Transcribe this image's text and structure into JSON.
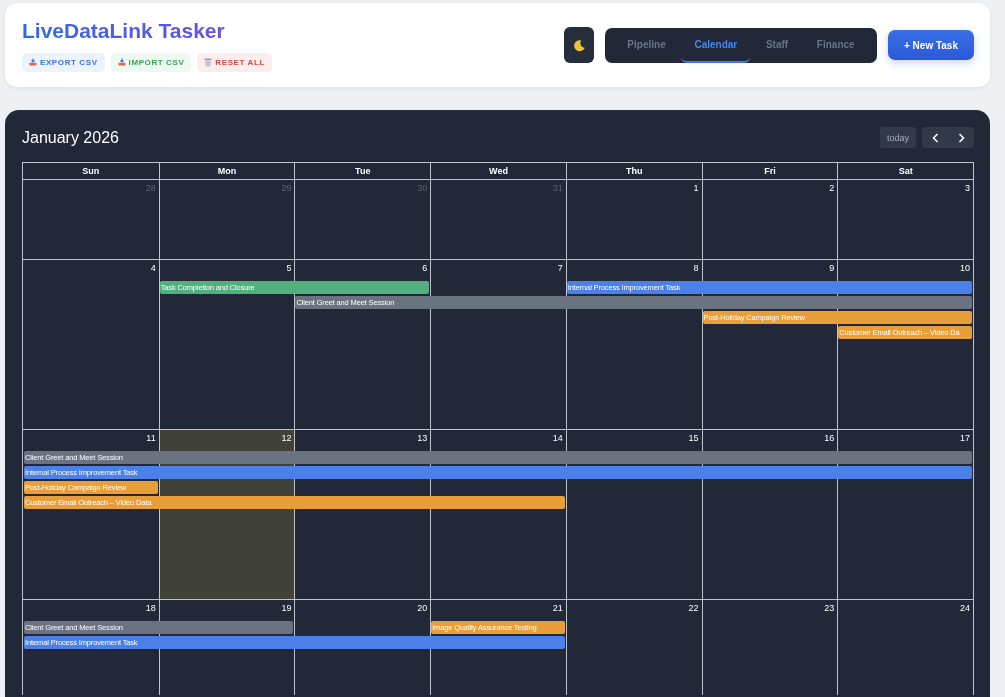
{
  "app": {
    "title": "LiveDataLink Tasker"
  },
  "actions": [
    {
      "label": "EXPORT CSV",
      "kind": "export"
    },
    {
      "label": "IMPORT CSV",
      "kind": "import"
    },
    {
      "label": "RESET ALL",
      "kind": "reset"
    }
  ],
  "theme_toggle": {
    "dark": true
  },
  "tabs": [
    {
      "label": "Pipeline",
      "selected": false
    },
    {
      "label": "Calendar",
      "selected": true
    },
    {
      "label": "Staff",
      "selected": false
    },
    {
      "label": "Finance",
      "selected": false
    }
  ],
  "new_task_button": "+ New Task",
  "calendar": {
    "title": "January 2026",
    "today_button": "today",
    "weekdays": [
      "Sun",
      "Mon",
      "Tue",
      "Wed",
      "Thu",
      "Fri",
      "Sat"
    ],
    "weeks": [
      {
        "days": [
          {
            "number": "28",
            "other_month": true,
            "today": false
          },
          {
            "number": "29",
            "other_month": true,
            "today": false
          },
          {
            "number": "30",
            "other_month": true,
            "today": false
          },
          {
            "number": "31",
            "other_month": true,
            "today": false
          },
          {
            "number": "1",
            "other_month": false,
            "today": false
          },
          {
            "number": "2",
            "other_month": false,
            "today": false
          },
          {
            "number": "3",
            "other_month": false,
            "today": false
          }
        ]
      },
      {
        "days": [
          {
            "number": "4",
            "other_month": false,
            "today": false
          },
          {
            "number": "5",
            "other_month": false,
            "today": false
          },
          {
            "number": "6",
            "other_month": false,
            "today": false
          },
          {
            "number": "7",
            "other_month": false,
            "today": false
          },
          {
            "number": "8",
            "other_month": false,
            "today": false
          },
          {
            "number": "9",
            "other_month": false,
            "today": false
          },
          {
            "number": "10",
            "other_month": false,
            "today": false
          }
        ],
        "events": [
          {
            "title": "Task Completion and Closure",
            "color": "#52b07e"
          },
          {
            "title": "Internal Process Improvement Task",
            "color": "#4a80e8"
          },
          {
            "title": "Client Greet and Meet Session",
            "color": "#6b7280"
          },
          {
            "title": "Post-Holiday Campaign Review",
            "color": "#e89f3a"
          },
          {
            "title": "Customer Email Outreach – Video Da",
            "color": "#e89f3a"
          }
        ]
      },
      {
        "days": [
          {
            "number": "11",
            "other_month": false,
            "today": false
          },
          {
            "number": "12",
            "other_month": false,
            "today": true
          },
          {
            "number": "13",
            "other_month": false,
            "today": false
          },
          {
            "number": "14",
            "other_month": false,
            "today": false
          },
          {
            "number": "15",
            "other_month": false,
            "today": false
          },
          {
            "number": "16",
            "other_month": false,
            "today": false
          },
          {
            "number": "17",
            "other_month": false,
            "today": false
          }
        ],
        "events": [
          {
            "title": "Client Greet and Meet Session",
            "color": "#6b7280"
          },
          {
            "title": "Internal Process Improvement Task",
            "color": "#4a80e8"
          },
          {
            "title": "Post-Holiday Campaign Review",
            "color": "#e89f3a"
          },
          {
            "title": "Customer Email Outreach – Video Data",
            "color": "#e89f3a"
          }
        ]
      },
      {
        "days": [
          {
            "number": "18",
            "other_month": false,
            "today": false
          },
          {
            "number": "19",
            "other_month": false,
            "today": false
          },
          {
            "number": "20",
            "other_month": false,
            "today": false
          },
          {
            "number": "21",
            "other_month": false,
            "today": false
          },
          {
            "number": "22",
            "other_month": false,
            "today": false
          },
          {
            "number": "23",
            "other_month": false,
            "today": false
          },
          {
            "number": "24",
            "other_month": false,
            "today": false
          }
        ],
        "events": [
          {
            "title": "Client Greet and Meet Session",
            "color": "#6b7280"
          },
          {
            "title": "Image Quality Assurance Testing",
            "color": "#e89f3a"
          },
          {
            "title": "Internal Process Improvement Task",
            "color": "#4a80e8"
          }
        ]
      }
    ]
  }
}
